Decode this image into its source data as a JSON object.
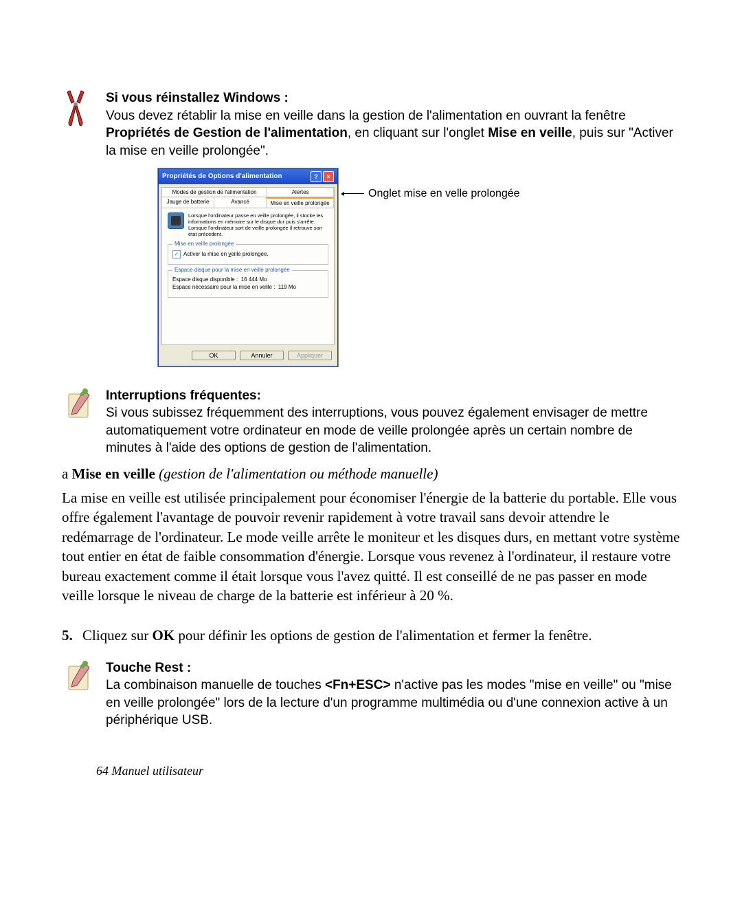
{
  "note1": {
    "title": "Si vous réinstallez Windows :",
    "line1a": "Vous devez rétablir la mise en veille dans la gestion de l'alimentation en ouvrant la fenêtre ",
    "bold1": "Propriétés de Gestion de l'alimentation",
    "line1b": ", en cliquant sur l'onglet ",
    "bold2": "Mise en veille",
    "line1c": ", puis sur \"Activer la mise en veille prolongée\"."
  },
  "dialog": {
    "title": "Propriétés de Options d'alimentation",
    "tabs_row1": [
      "Modes de gestion de l'alimentation",
      "Alertes"
    ],
    "tabs_row2": [
      "Jauge de batterie",
      "Avancé",
      "Mise en veille prolongée"
    ],
    "info_text": "Lorsque l'ordinateur passe en veille prolongée, il stocke les informations en mémoire sur le disque dur puis s'arrête. Lorsque l'ordinateur sort de veille prolongée il retrouve son état précédent.",
    "fieldset1_legend": "Mise en veille prolongée",
    "checkbox_label_pre": "Activer la mise en ",
    "checkbox_label_key": "v",
    "checkbox_label_post": "eille prolongée.",
    "fieldset2_legend": "Espace disque pour la mise en veille prolongée",
    "disk_free_label": "Espace disque disponible :",
    "disk_free_value": "16 444 Mo",
    "disk_req_label": "Espace nécessaire pour la mise en veille :",
    "disk_req_value": "119 Mo",
    "btn_ok": "OK",
    "btn_cancel": "Annuler",
    "btn_apply": "Appliquer"
  },
  "callout": "Onglet mise en velle prolongée",
  "note2": {
    "title": "Interruptions fréquentes:",
    "text": "Si vous subissez fréquemment des interruptions, vous pouvez également envisager de mettre automatiquement votre ordinateur en mode de veille prolongée après un certain nombre de minutes à l'aide des options de gestion de l'alimentation."
  },
  "section": {
    "prefix": "a ",
    "label": "Mise en veille",
    "paren": " (gestion de l'alimentation ou méthode manuelle)"
  },
  "body": "La mise en veille est utilisée principalement pour économiser l'énergie de la batterie du portable. Elle vous offre également l'avantage de pouvoir revenir rapidement à votre travail sans devoir attendre le redémarrage de l'ordinateur. Le mode veille arrête le moniteur et les disques durs, en mettant votre système tout entier en état de faible consommation d'énergie. Lorsque vous revenez à l'ordinateur, il restaure votre bureau exactement comme il était lorsque vous l'avez quitté. Il est conseillé de ne pas passer en mode veille lorsque le niveau de charge de la batterie est inférieur à 20 %.",
  "step": {
    "num": "5.",
    "pre": "Cliquez sur ",
    "bold": "OK",
    "post": " pour définir les options de gestion de l'alimentation et fermer la fenêtre."
  },
  "note3": {
    "title": "Touche Rest :",
    "pre": "La combinaison manuelle de touches ",
    "key": "<Fn+ESC>",
    "post": " n'active pas les modes \"mise en veille\" ou \"mise en veille prolongée\" lors de la lecture d'un programme multimédia ou d'une connexion active à un périphérique USB."
  },
  "footer": {
    "page": "64",
    "label": "  Manuel utilisateur"
  }
}
